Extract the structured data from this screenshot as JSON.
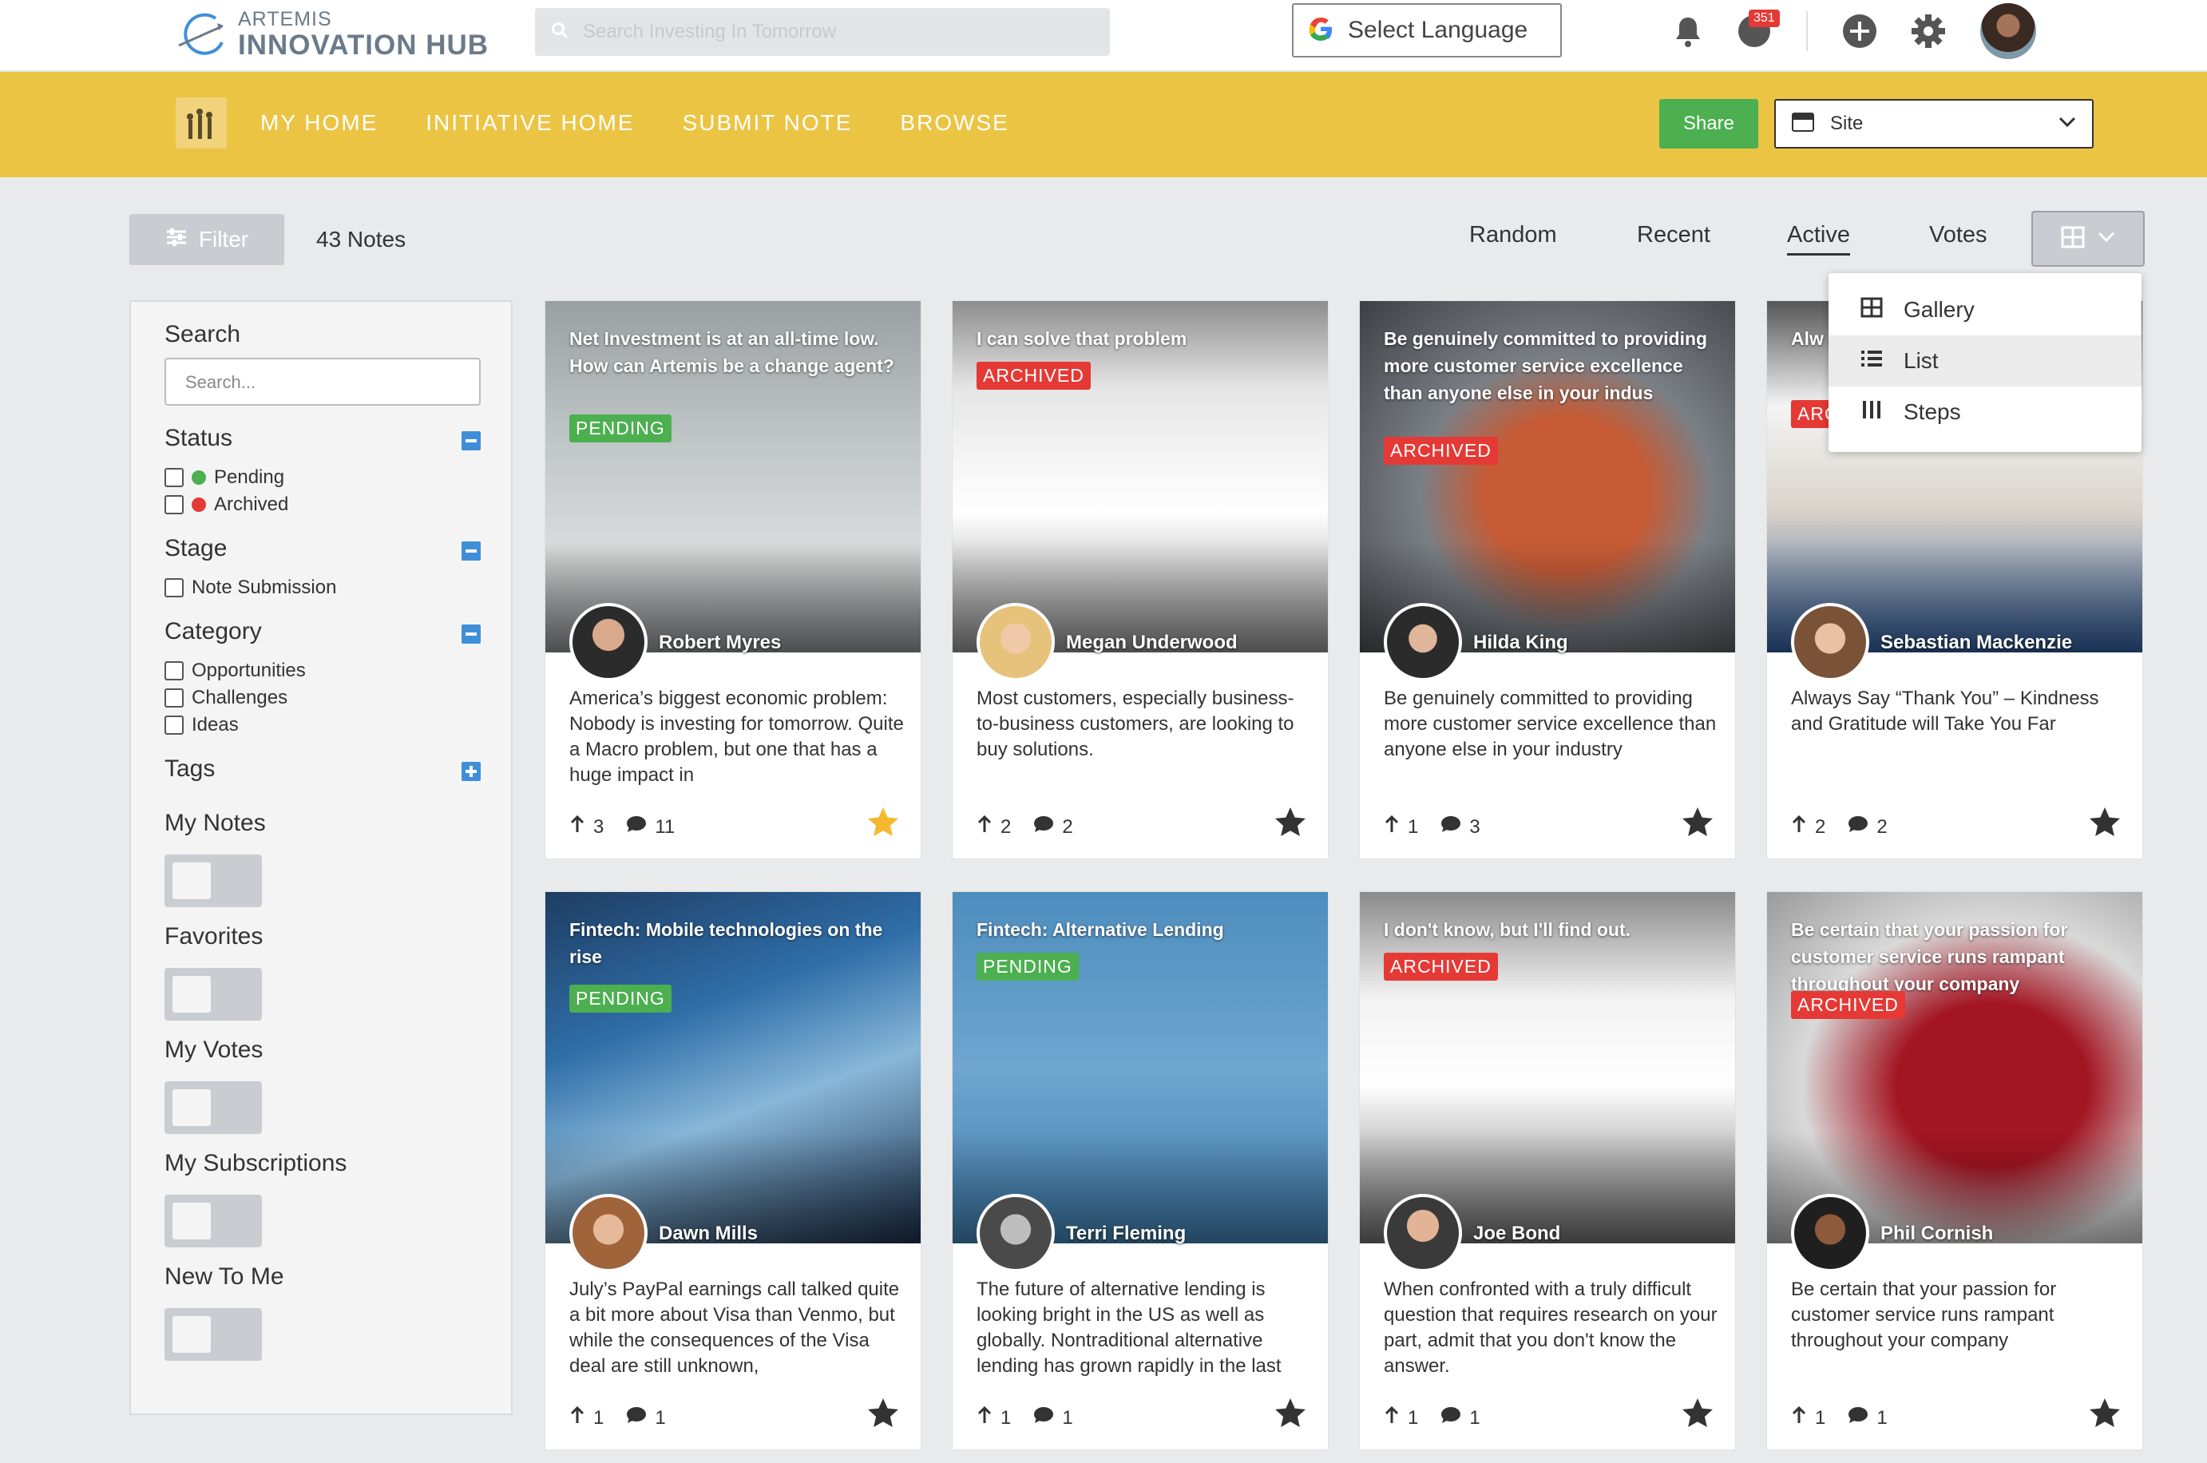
{
  "header": {
    "logo_small": "ARTEMIS",
    "logo_big": "INNOVATION HUB",
    "search_placeholder": "Search Investing In Tomorrow",
    "language_label": "Select Language",
    "notification_count": "351"
  },
  "nav": {
    "items": [
      "MY HOME",
      "INITIATIVE HOME",
      "SUBMIT NOTE",
      "BROWSE"
    ],
    "share_label": "Share",
    "site_label": "Site"
  },
  "toolbar": {
    "filter_label": "Filter",
    "note_count": "43 Notes",
    "sort_options": [
      "Random",
      "Recent",
      "Active",
      "Votes"
    ],
    "active_sort": "Active"
  },
  "view_menu": {
    "items": [
      "Gallery",
      "List",
      "Steps"
    ],
    "highlighted": "List"
  },
  "sidebar": {
    "search_title": "Search",
    "search_placeholder": "Search...",
    "status_title": "Status",
    "status_options": [
      "Pending",
      "Archived"
    ],
    "stage_title": "Stage",
    "stage_options": [
      "Note Submission"
    ],
    "category_title": "Category",
    "category_options": [
      "Opportunities",
      "Challenges",
      "Ideas"
    ],
    "tags_title": "Tags",
    "toggles": [
      "My Notes",
      "Favorites",
      "My Votes",
      "My Subscriptions",
      "New To Me"
    ]
  },
  "colors": {
    "brand_yellow": "#ecc444",
    "pending_green": "#4caf50",
    "archived_red": "#e53935",
    "star_gold": "#f5b82e"
  },
  "cards": [
    {
      "title": "Net Investment is at an all-time low. How can Artemis be a change agent?",
      "status": "PENDING",
      "author": "Robert Myres",
      "desc": "America’s biggest economic problem: Nobody is investing for tomorrow. Quite a Macro problem, but one that has a huge impact in",
      "votes": "3",
      "comments": "11",
      "starred": true
    },
    {
      "title": "I can solve that problem",
      "status": "ARCHIVED",
      "author": "Megan Underwood",
      "desc": "Most customers, especially business-to-business customers, are looking to buy solutions.",
      "votes": "2",
      "comments": "2",
      "starred": false
    },
    {
      "title": "Be genuinely committed to providing more customer service excellence than anyone else in your indus",
      "status": "ARCHIVED",
      "author": "Hilda King",
      "desc": "Be genuinely committed to providing more customer service excellence than anyone else in your industry",
      "votes": "1",
      "comments": "3",
      "starred": false
    },
    {
      "title": "Alw and",
      "status": "ARC",
      "author": "Sebastian Mackenzie",
      "desc": "Always Say “Thank You” – Kindness and Gratitude will Take You Far",
      "votes": "2",
      "comments": "2",
      "starred": false
    },
    {
      "title": "Fintech: Mobile technologies on the rise",
      "status": "PENDING",
      "author": "Dawn Mills",
      "desc": "July’s PayPal earnings call talked quite a bit more about Visa than Venmo, but while the consequences of the Visa deal are still unknown,",
      "votes": "1",
      "comments": "1",
      "starred": false
    },
    {
      "title": "Fintech: Alternative Lending",
      "status": "PENDING",
      "author": "Terri Fleming",
      "desc": "The future of alternative lending is looking bright in the US as well as globally. Nontraditional alternative lending has grown rapidly in the last",
      "votes": "1",
      "comments": "1",
      "starred": false
    },
    {
      "title": "I don't know, but I'll find out.",
      "status": "ARCHIVED",
      "author": "Joe Bond",
      "desc": "When confronted with a truly difficult question that requires research on your part, admit that you don't know the answer.",
      "votes": "1",
      "comments": "1",
      "starred": false
    },
    {
      "title": "Be certain that your passion for customer service runs rampant throughout your company",
      "status": "ARCHIVED",
      "author": "Phil Cornish",
      "desc": "Be certain that your passion for customer service runs rampant throughout your company",
      "votes": "1",
      "comments": "1",
      "starred": false
    }
  ]
}
